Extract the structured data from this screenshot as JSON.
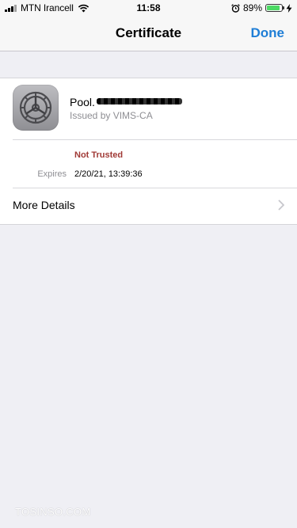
{
  "status_bar": {
    "carrier": "MTN Irancell",
    "time": "11:58",
    "battery": "89%",
    "battery_level": 0.89,
    "icons": [
      "signal-icon",
      "wifi-icon",
      "alarm-icon",
      "battery-icon",
      "charging-icon"
    ]
  },
  "nav": {
    "title": "Certificate",
    "done_label": "Done"
  },
  "certificate": {
    "name": "Pool.",
    "issuer": "Issued by VIMS-CA",
    "trust_status": "Not Trusted",
    "expires_label": "Expires",
    "expires_value": "2/20/21, 13:39:36",
    "more_details_label": "More Details",
    "icon": "settings-gear-icon"
  },
  "watermark": "TOSINSO.COM",
  "colors": {
    "accent": "#1f7ed6",
    "not_trusted": "#a03a36",
    "background": "#efeff4"
  }
}
